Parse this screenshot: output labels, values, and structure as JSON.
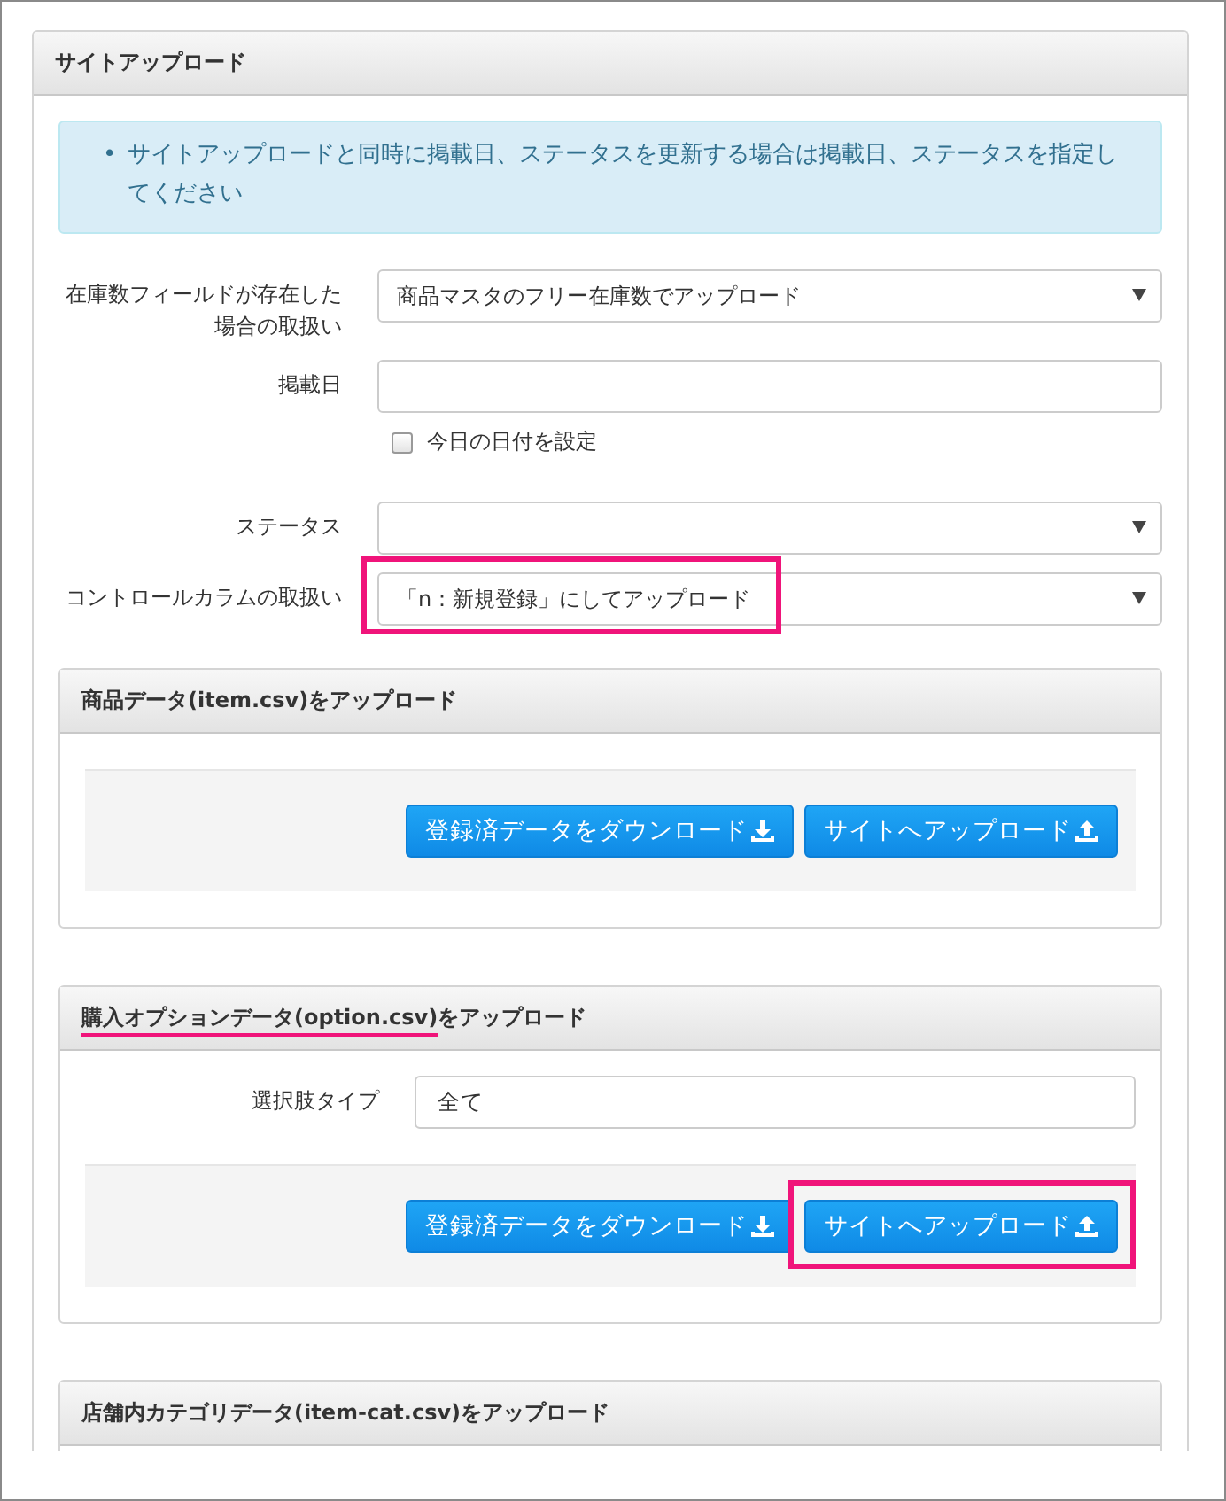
{
  "panel": {
    "title": "サイトアップロード",
    "notice": {
      "bullet": "•",
      "text": "サイトアップロードと同時に掲載日、ステータスを更新する場合は掲載日、ステータスを指定してください"
    },
    "fields": [
      {
        "kind": "select",
        "label": "在庫数フィールドが存在した場合の取扱い",
        "value": "商品マスタのフリー在庫数でアップロード",
        "highlighted": false
      },
      {
        "kind": "date",
        "label": "掲載日",
        "checkbox": {
          "label": "今日の日付を設定",
          "checked": false
        }
      },
      {
        "kind": "select",
        "label": "ステータス",
        "highlighted": false
      },
      {
        "kind": "select",
        "label": "コントロールカラムの取扱い",
        "value": "「n：新規登録」にしてアップロード",
        "highlighted": true
      }
    ],
    "sections": [
      {
        "title": [
          {
            "text": "商品データ(item.csv)をアップロード",
            "underlined": false
          }
        ],
        "buttons": [
          {
            "label": "登録済データをダウンロード",
            "highlighted": false
          },
          {
            "label": "サイトへアップロード",
            "highlighted": false
          }
        ]
      },
      {
        "title": [
          {
            "text": "購入オプションデータ(option.csv)",
            "underlined": true
          },
          {
            "text": "をアップロード",
            "underlined": false
          }
        ],
        "fields": [
          {
            "label": "選択肢タイプ",
            "value": "全て"
          }
        ],
        "buttons": [
          {
            "label": "登録済データをダウンロード",
            "highlighted": false
          },
          {
            "label": "サイトへアップロード",
            "highlighted": true
          }
        ]
      },
      {
        "title": [
          {
            "text": "店舗内カテゴリデータ(item-cat.csv)をアップロード",
            "underlined": false
          }
        ]
      }
    ]
  }
}
